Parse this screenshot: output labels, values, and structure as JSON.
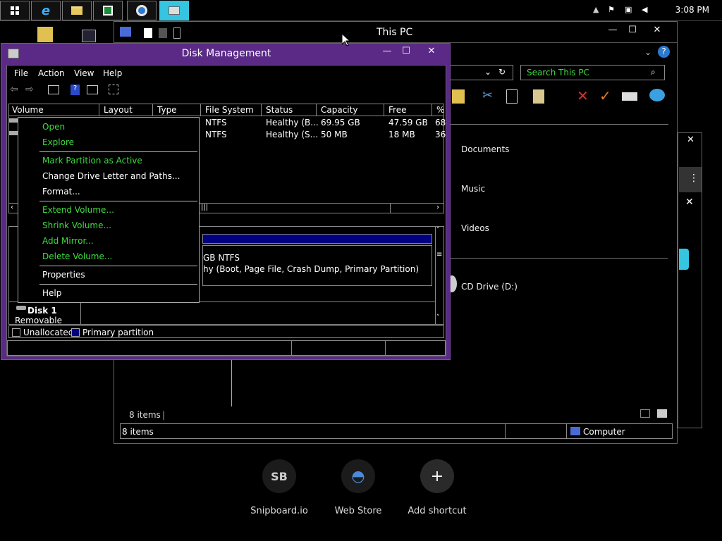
{
  "taskbar": {
    "clock": "3:08 PM",
    "apps": [
      {
        "name": "start",
        "icon": "windows-logo-icon"
      },
      {
        "name": "ie",
        "icon": "internet-explorer-icon"
      },
      {
        "name": "explorer",
        "icon": "folder-icon"
      },
      {
        "name": "excel",
        "icon": "spreadsheet-icon"
      },
      {
        "name": "chrome",
        "icon": "browser-icon"
      },
      {
        "name": "diskmgmt",
        "icon": "disk-management-icon"
      }
    ]
  },
  "newtab": {
    "shortcuts": [
      {
        "label": "Snipboard.io",
        "icon_text": "SB"
      },
      {
        "label": "Web Store",
        "icon_text": "◓"
      },
      {
        "label": "Add shortcut",
        "icon_text": "+"
      }
    ]
  },
  "thispc": {
    "title": "This PC",
    "search_placeholder": "Search This PC",
    "nav": [
      "Documents",
      "Music",
      "Videos",
      "CD Drive (D:)"
    ],
    "items_count": "8 items",
    "status_items": "8 items",
    "status_computer": "Computer"
  },
  "diskmgmt": {
    "title": "Disk Management",
    "menu": [
      "File",
      "Action",
      "View",
      "Help"
    ],
    "columns": [
      "Volume",
      "Layout",
      "Type",
      "File System",
      "Status",
      "Capacity",
      "Free Spa...",
      "% F"
    ],
    "rows": [
      {
        "fs": "NTFS",
        "status": "Healthy (B...",
        "capacity": "69.95 GB",
        "free": "47.59 GB",
        "pct": "68"
      },
      {
        "fs": "NTFS",
        "status": "Healthy (S...",
        "capacity": "50 MB",
        "free": "18 MB",
        "pct": "36"
      }
    ],
    "partition_line1": "GB NTFS",
    "partition_line2": "hy (Boot, Page File, Crash Dump, Primary Partition)",
    "disk1_label": "Disk 1",
    "disk1_type": "Removable",
    "legend_unallocated": "Unallocated",
    "legend_primary": "Primary partition",
    "colors": {
      "primary": "#000080",
      "frame": "#5a2a86"
    }
  },
  "context_menu": {
    "items": [
      {
        "label": "Open",
        "enabled": true
      },
      {
        "label": "Explore",
        "enabled": true
      },
      {
        "label": "Mark Partition as Active",
        "enabled": true
      },
      {
        "label": "Change Drive Letter and Paths...",
        "enabled": false
      },
      {
        "label": "Format...",
        "enabled": false
      },
      {
        "label": "Extend Volume...",
        "enabled": true
      },
      {
        "label": "Shrink Volume...",
        "enabled": true
      },
      {
        "label": "Add Mirror...",
        "enabled": true
      },
      {
        "label": "Delete Volume...",
        "enabled": true
      },
      {
        "label": "Properties",
        "enabled": false
      },
      {
        "label": "Help",
        "enabled": false
      }
    ]
  }
}
